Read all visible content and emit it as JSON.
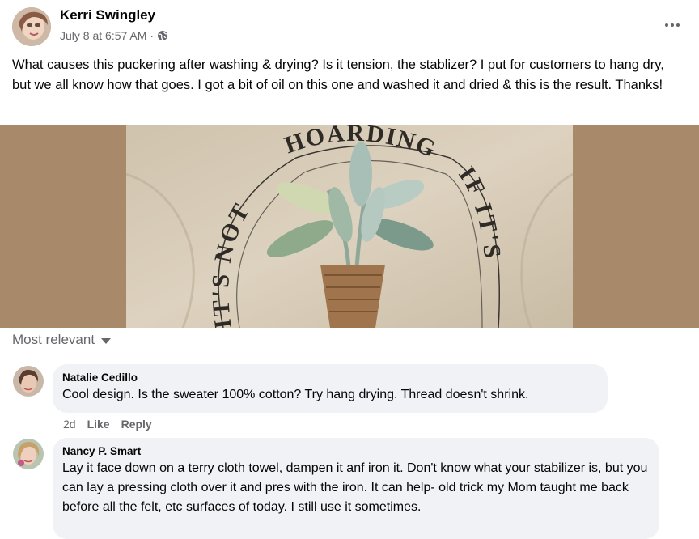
{
  "post": {
    "author": "Kerri Swingley",
    "timestamp": "July 8 at 6:57 AM",
    "separator": "·",
    "privacy_icon": "globe-icon",
    "more_icon": "more-options-icon",
    "text": "What causes this puckering after washing & drying? Is it tension, the stablizer? I put for customers to hang dry, but we all know how that goes. I got a bit of oil on this one and washed it and dried & this is the result. Thanks!",
    "image_text": {
      "left": "IT'S NOT",
      "top": "HOARDING",
      "right": "IF IT'S"
    }
  },
  "comments_header": {
    "sort_label": "Most relevant"
  },
  "comments": [
    {
      "name": "Natalie Cedillo",
      "text": "Cool design. Is the sweater 100% cotton? Try hang drying. Thread doesn't shrink.",
      "age": "2d",
      "like_label": "Like",
      "reply_label": "Reply"
    },
    {
      "name": "Nancy P. Smart",
      "text": "Lay it face down on a terry cloth towel, dampen it anf iron it. Don't know what your stabilizer is, but you can lay a pressing cloth over it and pres with the iron. It can help- old trick my Mom taught me back before all the felt, etc surfaces of today. I still use it sometimes."
    }
  ],
  "colors": {
    "photo_background": "#a8896a",
    "sweater": "#d7cbb6",
    "comment_bubble": "#f0f2f5",
    "secondary_text": "#65676b"
  }
}
